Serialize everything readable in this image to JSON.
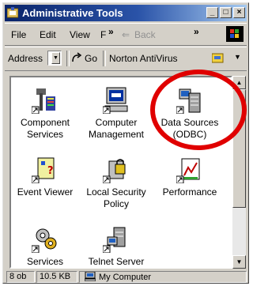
{
  "window": {
    "title": "Administrative Tools"
  },
  "title_buttons": {
    "minimize": "_",
    "maximize": "□",
    "close": "×"
  },
  "menu": {
    "file": "File",
    "edit": "Edit",
    "view": "View",
    "favorites": "F",
    "chevron": "»",
    "back": "Back",
    "back_arrow": "⇐",
    "chevron2": "»"
  },
  "address": {
    "label": "Address",
    "go": "Go",
    "norton": "Norton AntiVirus"
  },
  "icons": [
    {
      "label": "Component Services",
      "icon": "component-services-icon"
    },
    {
      "label": "Computer Management",
      "icon": "computer-management-icon"
    },
    {
      "label": "Data Sources (ODBC)",
      "icon": "data-sources-icon"
    },
    {
      "label": "Event Viewer",
      "icon": "event-viewer-icon"
    },
    {
      "label": "Local Security Policy",
      "icon": "local-security-icon"
    },
    {
      "label": "Performance",
      "icon": "performance-icon"
    },
    {
      "label": "Services",
      "icon": "services-icon"
    },
    {
      "label": "Telnet Server",
      "icon": "telnet-server-icon"
    }
  ],
  "status": {
    "objects": "8 ob",
    "size": "10.5 KB",
    "zone": "My Computer"
  },
  "colors": {
    "highlight_circle": "#e00000",
    "title_bar": "#0a246a"
  }
}
